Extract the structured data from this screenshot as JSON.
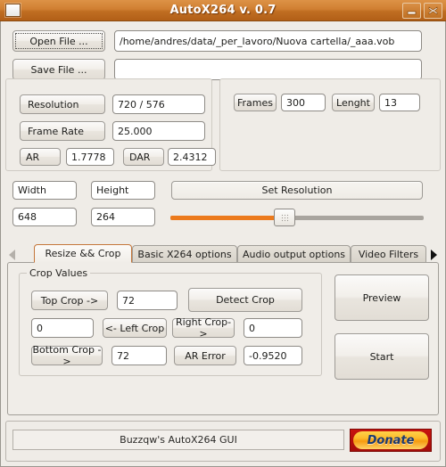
{
  "window": {
    "title": "AutoX264 v. 0.7",
    "icon": "window-icon",
    "minimize_label": "minimize-icon",
    "close_label": "close-icon"
  },
  "file_section": {
    "open_button": "Open File ...",
    "open_path": "/home/andres/data/_per_lavoro/Nuova cartella/_aaa.vob",
    "save_button": "Save File ...",
    "save_path": "",
    "save_placeholder": ""
  },
  "info_panel": {
    "resolution_label": "Resolution",
    "resolution_value": "720 / 576",
    "framerate_label": "Frame Rate",
    "framerate_value": "25.000",
    "ar_label": "AR",
    "ar_value": "1.7778",
    "dar_label": "DAR",
    "dar_value": "2.4312"
  },
  "frames_panel": {
    "frames_label": "Frames",
    "frames_value": "300",
    "length_label": "Lenght",
    "length_value": "13"
  },
  "resize_row": {
    "width_label": "Width",
    "height_label": "Height",
    "set_resolution_button": "Set Resolution",
    "width_value": "648",
    "height_value": "264",
    "slider_percent": 45,
    "slider_fill_color": "#ec7a1c"
  },
  "tabs": {
    "scroll_left": "arrow-left-icon",
    "scroll_right": "arrow-right-icon",
    "items": [
      {
        "label": "Resize && Crop",
        "active": true
      },
      {
        "label": "Basic X264 options",
        "active": false
      },
      {
        "label": "Audio output options",
        "active": false
      },
      {
        "label": "Video Filters",
        "active": false
      }
    ]
  },
  "crop": {
    "group_title": "Crop Values",
    "top_crop_label": "Top Crop ->",
    "top_crop_value": "72",
    "detect_crop_button": "Detect Crop",
    "left_crop_value": "0",
    "left_crop_label": "<- Left Crop",
    "right_crop_label": "Right Crop->",
    "right_crop_value": "0",
    "bottom_crop_label": "Bottom Crop ->",
    "bottom_crop_value": "72",
    "ar_error_label": "AR Error",
    "ar_error_value": "-0.9520"
  },
  "actions": {
    "preview_button": "Preview",
    "start_button": "Start"
  },
  "statusbar": {
    "text": "Buzzqw's AutoX264 GUI",
    "donate_button": "Donate"
  }
}
